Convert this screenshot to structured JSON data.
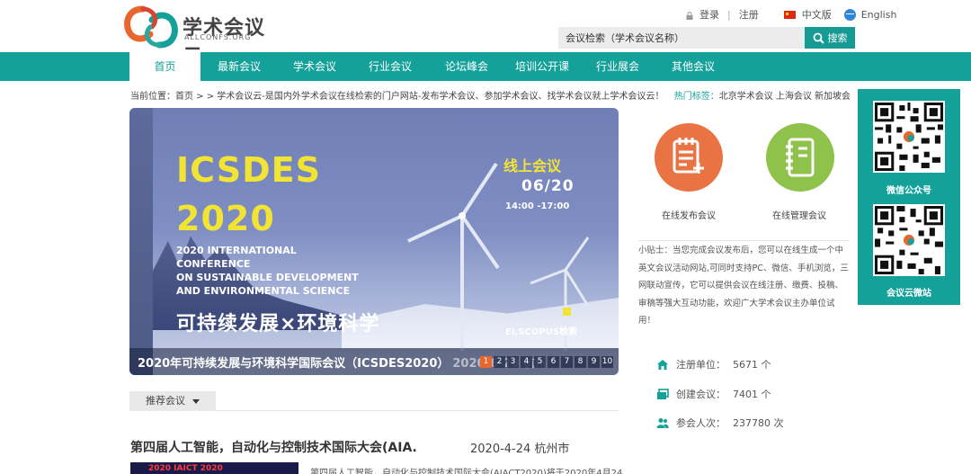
{
  "brand": {
    "name": "学术会议云",
    "sub": "ALLCONFS.ORG",
    "colors": {
      "teal": "#13a19a",
      "orange": "#e9662d",
      "red": "#d64531",
      "yellow": "#f2e435"
    }
  },
  "toplinks": {
    "login": "登录",
    "register": "注册",
    "chinese": "中文版",
    "english": "English"
  },
  "search": {
    "value": "会议检索（学术会议名称）",
    "button": "搜索",
    "icon": "search-icon"
  },
  "nav": {
    "items": [
      {
        "label": "首页"
      },
      {
        "label": "最新会议"
      },
      {
        "label": "学术会议"
      },
      {
        "label": "行业会议"
      },
      {
        "label": "论坛峰会"
      },
      {
        "label": "培训公开课"
      },
      {
        "label": "行业展会"
      },
      {
        "label": "其他会议"
      }
    ]
  },
  "breadcrumb": {
    "text": "当前位置：首页 > > 学术会议云-是国内外学术会议在线检索的门户网站-发布学术会议、参加学术会议、找学术会议就上学术会议云！",
    "hot_label": "热门标签：",
    "hot_tags": "北京学术会议 上海会议 新加坡会议"
  },
  "banner": {
    "title1": "ICSDES",
    "title2": "2020",
    "english": [
      "2020 INTERNATIONAL CONFERENCE",
      "ON SUSTAINABLE DEVELOPMENT",
      "AND ENVIRONMENTAL SCIENCE"
    ],
    "online": "线上会议",
    "date": "06/20",
    "time": "14:00 -17:00",
    "chinese": "可持续发展×环境科学",
    "index": "EI,SCOPUS检索",
    "caption": "2020年可持续发展与环境科学国际会议（ICSDES2020）",
    "caption_overlap": "2020-6-20 杭州",
    "pages": [
      "1",
      "2",
      "3",
      "4",
      "5",
      "6",
      "7",
      "8",
      "9",
      "10"
    ],
    "active_page": "1"
  },
  "recommend": {
    "tab": "推荐会议"
  },
  "conference": {
    "title": "第四届人工智能，自动化与控制技术国际大会(AIA.",
    "date": "2020-4-24 杭州市",
    "thumb_text": "2020 IAICT 2020",
    "desc": "第四届人工智能，自动化与控制技术国际大会(AIACT2020)将于2020年4月24"
  },
  "services": {
    "publish": "在线发布会议",
    "manage": "在线管理会议"
  },
  "tip": {
    "text": "小贴士：当您完成会议发布后，您可以在线生成一个中英文会议活动网站,可同时支持PC、微信、手机浏览，三网联动宣传，它可以提供会议在线注册、缴费、投稿、审稿等强大互动功能，欢迎广大学术会议主办单位试用！"
  },
  "stats": [
    {
      "label": "注册单位：",
      "value": "5671 个",
      "icon": "building-icon"
    },
    {
      "label": "创建会议：",
      "value": "7401 个",
      "icon": "window-icon"
    },
    {
      "label": "参会人次：",
      "value": "237780 次",
      "icon": "people-icon"
    }
  ],
  "sidebar": {
    "wechat": "微信公众号",
    "weibo": "会议云微站"
  }
}
